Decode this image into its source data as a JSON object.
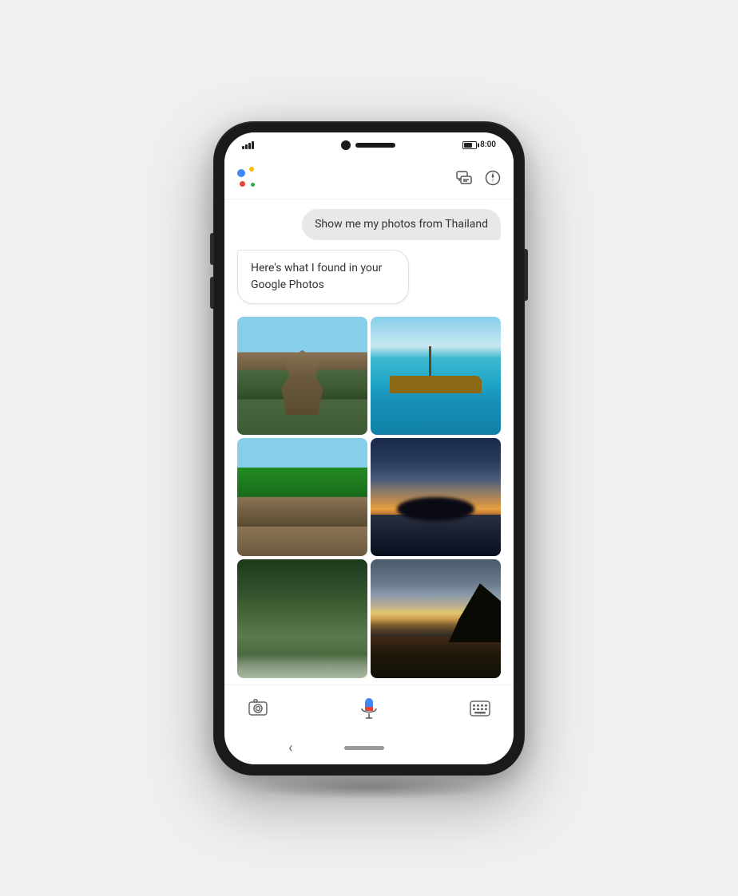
{
  "phone": {
    "status_bar": {
      "time": "8:00"
    },
    "assistant_header": {
      "logo_alt": "Google Assistant",
      "icon_feedback": "feedback-icon",
      "icon_more": "more-options-icon"
    },
    "chat": {
      "user_message": "Show me my photos from Thailand",
      "assistant_message": "Here's what I found in your Google Photos",
      "photos": [
        {
          "id": "temple",
          "alt": "Ayutthaya temples Thailand",
          "class": "photo-temple"
        },
        {
          "id": "boat",
          "alt": "Boat on turquoise water Thailand",
          "class": "photo-boat"
        },
        {
          "id": "train",
          "alt": "Train through jungle Thailand",
          "class": "photo-train"
        },
        {
          "id": "sunset",
          "alt": "Sunset silhouette over water Thailand",
          "class": "photo-sunset"
        },
        {
          "id": "jungle",
          "alt": "Jungle waterfall Thailand",
          "class": "photo-jungle"
        },
        {
          "id": "dusk",
          "alt": "Dusk over water Thailand",
          "class": "photo-dusk"
        }
      ]
    },
    "toolbar": {
      "lens_icon": "camera-lens-icon",
      "mic_icon": "microphone-icon",
      "keyboard_icon": "keyboard-icon"
    },
    "nav_bar": {
      "back_label": "‹",
      "home_pill": "home-pill"
    }
  }
}
